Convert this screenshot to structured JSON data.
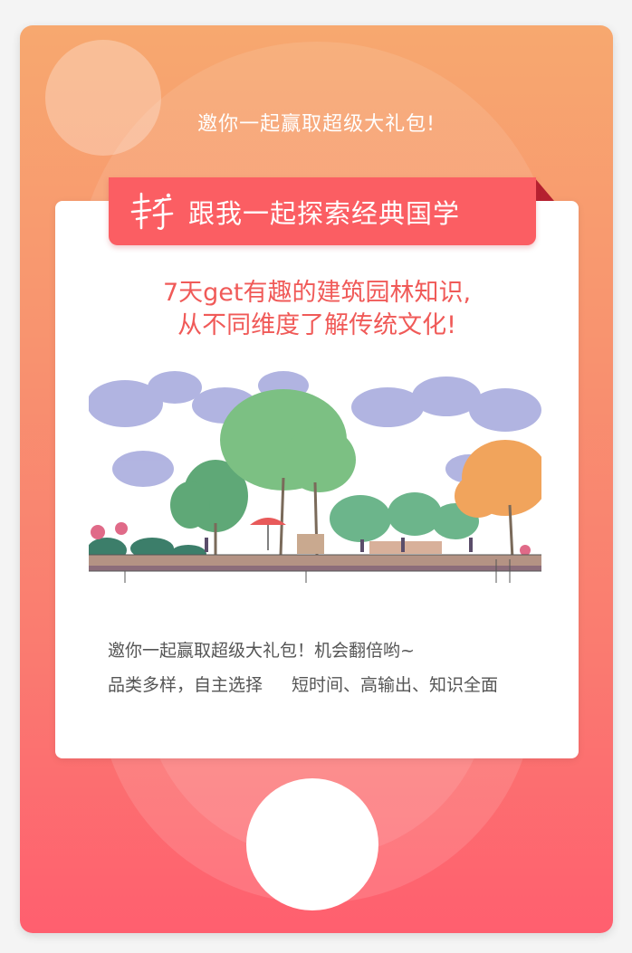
{
  "invite_title": "邀你一起赢取超级大礼包!",
  "ribbon": {
    "logo_text": "书香",
    "title": "跟我一起探索经典国学"
  },
  "headline": {
    "line1": "7天get有趣的建筑园林知识,",
    "line2": "从不同维度了解传统文化!"
  },
  "description": {
    "line1": "邀你一起赢取超级大礼包！机会翻倍哟~",
    "line2a": "品类多样，自主选择",
    "line2b": "短时间、高输出、知识全面"
  },
  "colors": {
    "gradient_top": "#f7a86f",
    "gradient_bottom": "#ff5f6f",
    "ribbon": "#fb5e63",
    "headline": "#f05a58",
    "body_text": "#555555"
  }
}
